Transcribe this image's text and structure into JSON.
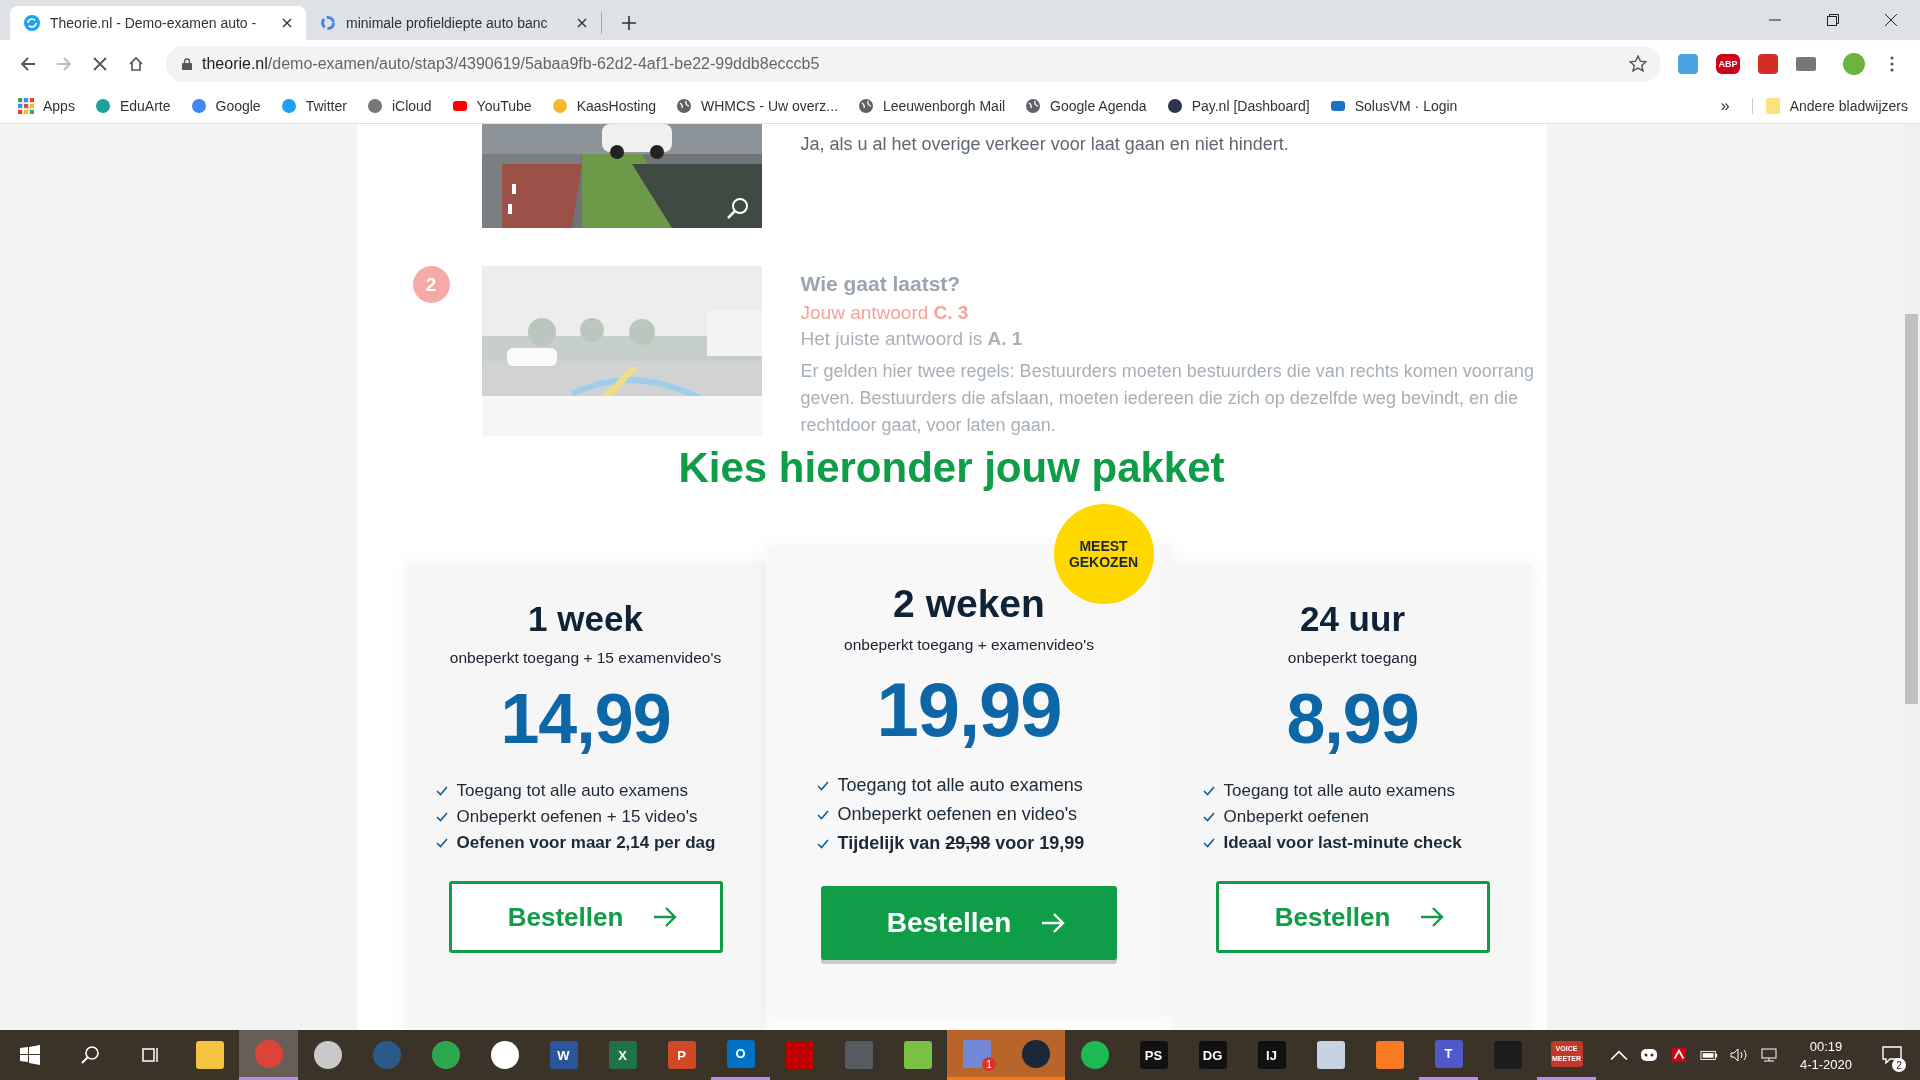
{
  "browser": {
    "tabs": [
      {
        "title": "Theorie.nl - Demo-examen auto -",
        "kind": "theorie",
        "selected": true
      },
      {
        "title": "minimale profieldiepte auto banc",
        "kind": "google",
        "selected": false
      }
    ],
    "address": {
      "host": "theorie.nl",
      "path": "/demo-examen/auto/stap3/4390619/5abaa9fb-62d2-4af1-be22-99ddb8ecccb5"
    },
    "extensions": [
      {
        "kind": "translate"
      },
      {
        "kind": "adblock",
        "label": "ABP"
      },
      {
        "kind": "lastpass"
      },
      {
        "kind": "reader"
      },
      {
        "kind": "avatar"
      }
    ],
    "bookmarks": [
      {
        "label": "Apps",
        "kind": "apps"
      },
      {
        "label": "EduArte",
        "kind": "edu"
      },
      {
        "label": "Google",
        "kind": "google"
      },
      {
        "label": "Twitter",
        "kind": "twitter"
      },
      {
        "label": "iCloud",
        "kind": "apple"
      },
      {
        "label": "YouTube",
        "kind": "youtube"
      },
      {
        "label": "KaasHosting",
        "kind": "cheese"
      },
      {
        "label": "WHMCS - Uw overz...",
        "kind": "globe"
      },
      {
        "label": "Leeuwenborgh Mail",
        "kind": "globe"
      },
      {
        "label": "Google Agenda",
        "kind": "globe"
      },
      {
        "label": "Pay.nl [Dashboard]",
        "kind": "pay"
      },
      {
        "label": "SolusVM · Login",
        "kind": "solus"
      }
    ],
    "more_bookmarks": "»",
    "other_bookmarks": "Andere bladwijzers"
  },
  "questions": [
    {
      "answer": "Ja, als u al het overige verkeer voor laat gaan en niet hindert."
    },
    {
      "number": "2",
      "correct": false,
      "title": "Wie gaat laatst?",
      "your_answer": "Jouw antwoord **C. 3**",
      "right_answer": "Het juiste antwoord is **A. 1**",
      "explanation": "Er gelden hier twee regels: Bestuurders moeten bestuurders die van rechts komen voorrang geven. Bestuurders die afslaan, moeten iedereen die zich op dezelfde weg bevindt, en die rechtdoor gaat, voor laten gaan."
    }
  ],
  "packages_heading": "Kies hieronder jouw pakket",
  "packages": [
    {
      "title": "1 week",
      "subtitle": "onbeperkt toegang + 15 examenvideo's",
      "price": "14,99",
      "featured": false,
      "features": [
        {
          "text": "Toegang tot alle auto examens",
          "bold": false
        },
        {
          "text": "Onbeperkt oefenen + 15 video's",
          "bold": false
        },
        {
          "text": "Oefenen voor maar 2,14 per dag",
          "bold": true
        }
      ],
      "button": "Bestellen"
    },
    {
      "title": "2 weken",
      "subtitle": "onbeperkt toegang + examenvideo's",
      "price": "19,99",
      "featured": true,
      "badge": "MEEST GEKOZEN",
      "features": [
        {
          "text": "Toegang tot alle auto examens",
          "bold": false
        },
        {
          "text": "Onbeperkt oefenen en video's",
          "bold": false
        },
        {
          "text": "Tijdelijk van",
          "struck": "29,98",
          "after": "voor 19,99",
          "bold": true
        }
      ],
      "button": "Bestellen"
    },
    {
      "title": "24 uur",
      "subtitle": "onbeperkt toegang",
      "price": "8,99",
      "featured": false,
      "features": [
        {
          "text": "Toegang tot alle auto examens",
          "bold": false
        },
        {
          "text": "Onbeperkt oefenen",
          "bold": false
        },
        {
          "text": "Ideaal voor last-minute check",
          "bold": true
        }
      ],
      "button": "Bestellen"
    }
  ],
  "taskbar": {
    "apps": [
      {
        "kind": "explorer",
        "selected": false,
        "running": false,
        "flashing": false
      },
      {
        "kind": "chrome",
        "selected": true,
        "running": true,
        "flashing": false
      },
      {
        "kind": "opera",
        "selected": false,
        "running": false,
        "flashing": false
      },
      {
        "kind": "teamspeak",
        "selected": false,
        "running": false,
        "flashing": false
      },
      {
        "kind": "edge",
        "selected": false,
        "running": false,
        "flashing": false
      },
      {
        "kind": "slack",
        "selected": false,
        "running": false,
        "flashing": false
      },
      {
        "kind": "word",
        "label": "W",
        "selected": false,
        "running": false,
        "flashing": false
      },
      {
        "kind": "excel",
        "label": "X",
        "selected": false,
        "running": false,
        "flashing": false
      },
      {
        "kind": "powerpoint",
        "label": "P",
        "selected": false,
        "running": false,
        "flashing": false
      },
      {
        "kind": "outlook",
        "label": "O",
        "selected": false,
        "running": true,
        "flashing": false
      },
      {
        "kind": "filezilla",
        "selected": false,
        "running": false,
        "flashing": false
      },
      {
        "kind": "vpn",
        "selected": false,
        "running": false,
        "flashing": false
      },
      {
        "kind": "git",
        "selected": false,
        "running": false,
        "flashing": false
      },
      {
        "kind": "discord",
        "badge": "1",
        "selected": false,
        "running": false,
        "flashing": true
      },
      {
        "kind": "steam",
        "selected": false,
        "running": false,
        "flashing": true
      },
      {
        "kind": "spotify",
        "selected": false,
        "running": false,
        "flashing": false
      },
      {
        "kind": "jetbrains",
        "label": "PS",
        "selected": false,
        "running": false,
        "flashing": false
      },
      {
        "kind": "jetbrains",
        "label": "DG",
        "selected": false,
        "running": false,
        "flashing": false
      },
      {
        "kind": "jetbrains",
        "label": "IJ",
        "selected": false,
        "running": false,
        "flashing": false
      },
      {
        "kind": "monitor",
        "selected": false,
        "running": false,
        "flashing": false
      },
      {
        "kind": "xampp",
        "selected": false,
        "running": false,
        "flashing": false
      },
      {
        "kind": "teams",
        "label": "T",
        "selected": false,
        "running": true,
        "flashing": false
      },
      {
        "kind": "ghost",
        "selected": false,
        "running": false,
        "flashing": false
      },
      {
        "kind": "voicemeeter",
        "label": "VOICE",
        "label2": "MEETER",
        "selected": false,
        "running": true,
        "flashing": false
      }
    ],
    "time": "00:19",
    "date": "4-1-2020",
    "notifications": "2"
  }
}
